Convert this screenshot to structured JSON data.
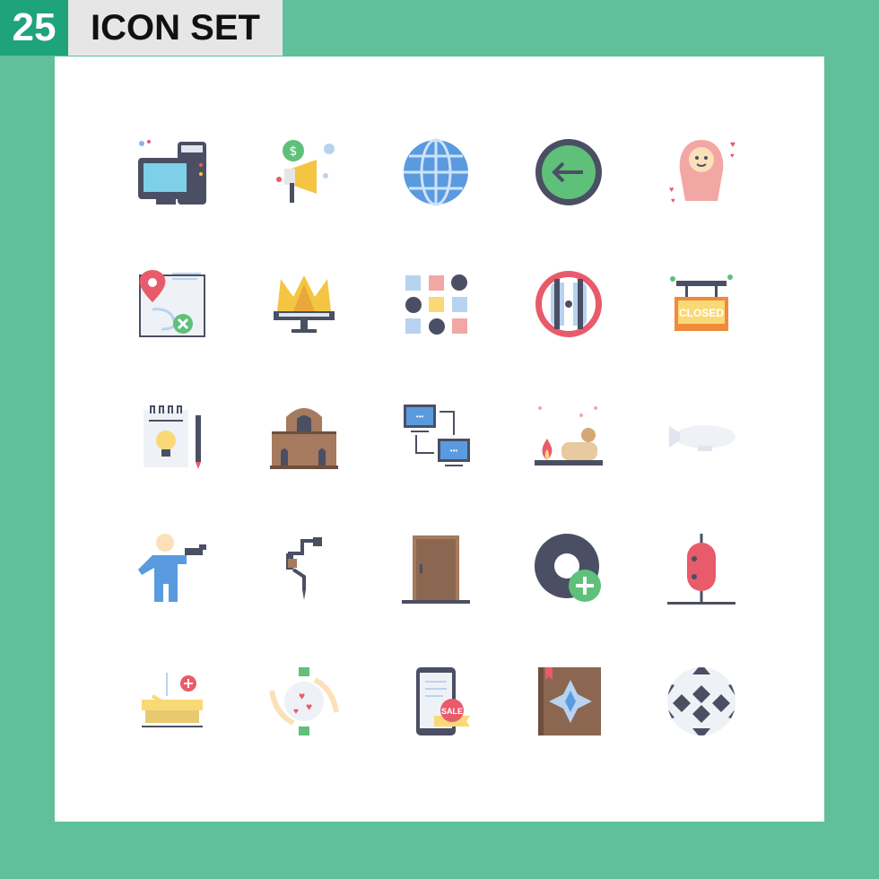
{
  "header": {
    "count": "25",
    "title": "ICON SET"
  },
  "icons": [
    "cash-register-icon",
    "marketing-megaphone-icon",
    "globe-icon",
    "arrow-left-circle-icon",
    "baby-icon",
    "map-location-remove-icon",
    "crown-monitor-icon",
    "grid-layout-icon",
    "football-ball-icon",
    "closed-sign-icon",
    "idea-notebook-icon",
    "building-icon",
    "computer-network-icon",
    "food-cooking-icon",
    "airship-icon",
    "man-pointing-icon",
    "hand-drill-icon",
    "door-icon",
    "add-tyre-icon",
    "punching-bag-icon",
    "hospital-bed-add-icon",
    "love-care-hands-icon",
    "mobile-sale-icon",
    "book-star-icon",
    "football-icon"
  ],
  "labels": {
    "closed_sign": "CLOSED",
    "sale_badge": "SALE"
  },
  "colors": {
    "background": "#5fc09b",
    "badge": "#1fa37a",
    "title_box": "#e6e6e6",
    "panel": "#ffffff"
  }
}
